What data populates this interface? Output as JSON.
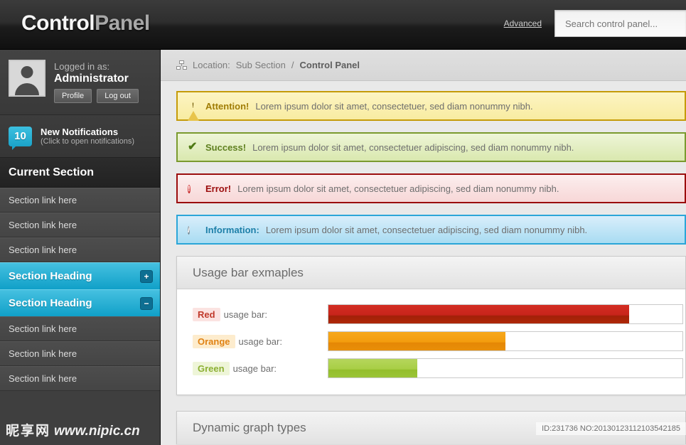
{
  "header": {
    "logo_primary": "Control",
    "logo_secondary": "Panel",
    "advanced_link": "Advanced",
    "search_placeholder": "Search control panel...",
    "search_value": ""
  },
  "sidebar": {
    "user": {
      "logged_label": "Logged in as:",
      "name": "Administrator",
      "profile_button": "Profile",
      "logout_button": "Log out"
    },
    "notifications": {
      "count": "10",
      "title": "New Notifications",
      "subtitle": "(Click to open notifications)"
    },
    "current_section": "Current Section",
    "links_top": [
      {
        "label": "Section link here"
      },
      {
        "label": "Section link here"
      },
      {
        "label": "Section link here"
      }
    ],
    "heading_collapsed": {
      "label": "Section Heading",
      "toggle": "+"
    },
    "heading_expanded": {
      "label": "Section Heading",
      "toggle": "−"
    },
    "links_bottom": [
      {
        "label": "Section link here"
      },
      {
        "label": "Section link here"
      },
      {
        "label": "Section link here"
      }
    ],
    "watermark_cn": "昵享网",
    "watermark_url": "www.nipic.cn"
  },
  "breadcrumb": {
    "label": "Location:",
    "parent": "Sub Section",
    "separator": "/",
    "current": "Control Panel"
  },
  "alerts": [
    {
      "type": "warning",
      "icon": "warning-triangle-icon",
      "lead": "Attention!",
      "message": "Lorem ipsum dolor sit amet, consectetuer, sed diam nonummy nibh.",
      "color": "#c59b09"
    },
    {
      "type": "success",
      "icon": "check-icon",
      "lead": "Success!",
      "message": "Lorem ipsum dolor sit amet, consectetuer adipiscing, sed diam nonummy nibh.",
      "color": "#7a9a2e"
    },
    {
      "type": "error",
      "icon": "error-circle-icon",
      "lead": "Error!",
      "message": "Lorem ipsum dolor sit amet, consectetuer adipiscing, sed diam nonummy nibh.",
      "color": "#9b0d0d"
    },
    {
      "type": "information",
      "icon": "info-circle-icon",
      "lead": "Information:",
      "message": "Lorem ipsum dolor sit amet, consectetuer adipiscing, sed diam nonummy nibh.",
      "color": "#2ba6d8"
    }
  ],
  "usage_panel": {
    "title": "Usage bar exmaples",
    "suffix": "usage bar:",
    "bars": [
      {
        "chip": "Red",
        "percent": 85,
        "color": "#c8241b"
      },
      {
        "chip": "Orange",
        "percent": 50,
        "color": "#f39c0d"
      },
      {
        "chip": "Green",
        "percent": 25,
        "color": "#a8ce45"
      }
    ]
  },
  "graph_panel": {
    "title": "Dynamic graph types"
  },
  "watermark_id": "ID:231736 NO:20130123112103542185"
}
